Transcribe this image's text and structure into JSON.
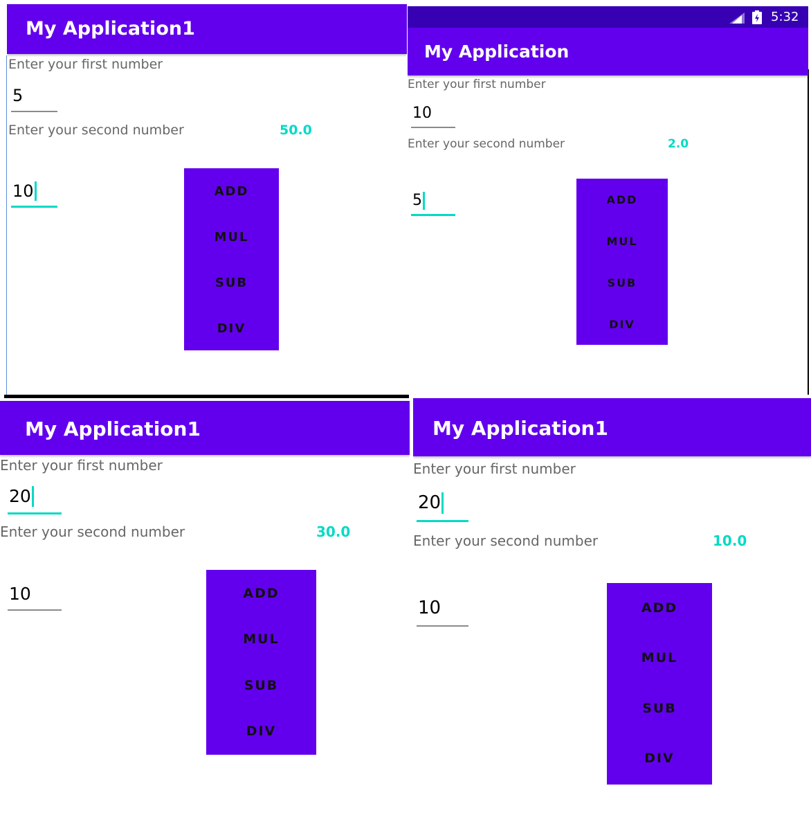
{
  "colors": {
    "primary": "#6200ee",
    "primary_dark": "#3700b3",
    "accent": "#03dac5"
  },
  "screens": [
    {
      "title": "My Application1",
      "first_label": "Enter your first number",
      "first_value": "5",
      "second_label": "Enter your second number",
      "second_value": "10",
      "result": "50.0",
      "buttons": [
        "ADD",
        "MUL",
        "SUB",
        "DIV"
      ]
    },
    {
      "title": "My Application",
      "status_time": "5:32",
      "first_label": "Enter your first number",
      "first_value": "10",
      "second_label": "Enter your second number",
      "second_value": "5",
      "result": "2.0",
      "buttons": [
        "ADD",
        "MUL",
        "SUB",
        "DIV"
      ]
    },
    {
      "title": "My Application1",
      "first_label": "Enter your first number",
      "first_value": "20",
      "second_label": "Enter your second number",
      "second_value": "10",
      "result": "30.0",
      "buttons": [
        "ADD",
        "MUL",
        "SUB",
        "DIV"
      ]
    },
    {
      "title": "My Application1",
      "first_label": "Enter your first number",
      "first_value": "20",
      "second_label": "Enter your second number",
      "second_value": "10",
      "result": "10.0",
      "buttons": [
        "ADD",
        "MUL",
        "SUB",
        "DIV"
      ]
    }
  ]
}
